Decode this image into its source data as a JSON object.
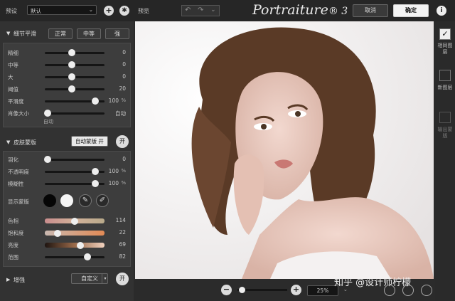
{
  "topbar": {
    "preset_label": "预设",
    "preset_value": "默认",
    "preview_label": "预览",
    "logo_text": "Portraiture",
    "logo_version": "® 3",
    "cancel": "取消",
    "ok": "确定",
    "info_glyph": "i"
  },
  "detail": {
    "title": "细节平滑",
    "normal": "正常",
    "medium": "中等",
    "strong": "强",
    "sliders": [
      {
        "label": "精细",
        "value": "0",
        "pos": 0.45
      },
      {
        "label": "中等",
        "value": "0",
        "pos": 0.45
      },
      {
        "label": "大",
        "value": "0",
        "pos": 0.45
      },
      {
        "label": "阈值",
        "value": "20",
        "pos": 0.45
      },
      {
        "label": "平滑度",
        "value": "100",
        "unit": "%",
        "pos": 0.85
      }
    ],
    "portrait_size_label": "肖像大小",
    "portrait_size_value": "自动",
    "portrait_size_sub": "自动"
  },
  "skin": {
    "title": "皮肤蒙版",
    "auto_mask": "自动蒙版 开",
    "toggle": "开",
    "sliders": [
      {
        "label": "羽化",
        "value": "0",
        "pos": 0.05
      },
      {
        "label": "不透明度",
        "value": "100",
        "unit": "%",
        "pos": 0.85
      },
      {
        "label": "模糊性",
        "value": "100",
        "unit": "%",
        "pos": 0.85
      }
    ],
    "show_mask_label": "显示蒙版",
    "colors": [
      {
        "label": "色相",
        "value": "114",
        "pos": 0.5
      },
      {
        "label": "饱和度",
        "value": "22",
        "pos": 0.22
      },
      {
        "label": "亮度",
        "value": "69",
        "pos": 0.6
      },
      {
        "label": "范围",
        "value": "82",
        "pos": 0.72
      }
    ]
  },
  "enhance": {
    "title": "增强",
    "custom": "自定义",
    "toggle": "开"
  },
  "zoom": {
    "minus": "−",
    "plus": "+",
    "value": "25%"
  },
  "right": {
    "match": "相同图层",
    "new": "新图层",
    "export": "输出蒙版"
  },
  "watermark": "知乎 @设计师柠檬"
}
